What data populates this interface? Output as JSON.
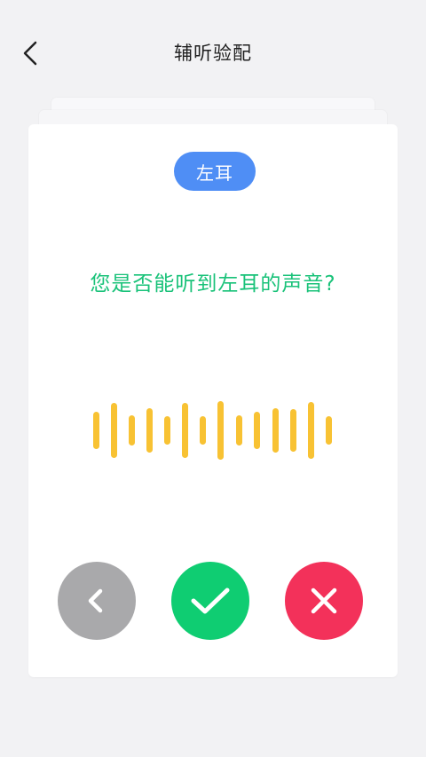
{
  "header": {
    "title": "辅听验配",
    "back_icon": "chevron-left-icon"
  },
  "card": {
    "ear_label": "左耳",
    "question": "您是否能听到左耳的声音?",
    "actions": {
      "back_icon": "chevron-left-icon",
      "yes_icon": "checkmark-icon",
      "no_icon": "close-icon"
    }
  },
  "colors": {
    "background": "#f2f2f4",
    "card": "#ffffff",
    "ear_badge": "#4f8ef5",
    "question_text": "#19c279",
    "waveform": "#f8c233",
    "back_button": "#a9a9ab",
    "yes_button": "#0fcd72",
    "no_button": "#f3315a"
  }
}
